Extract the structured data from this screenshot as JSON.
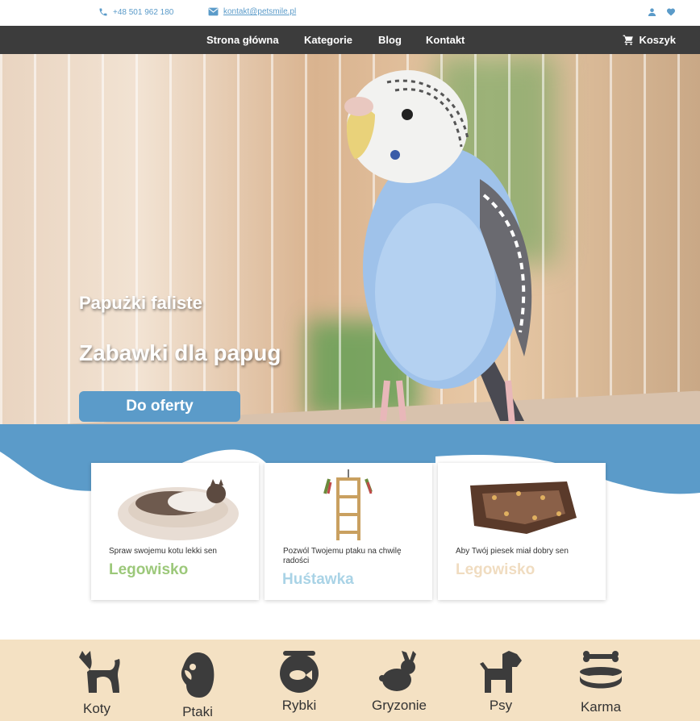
{
  "topbar": {
    "phone": "+48 501 962 180",
    "email": "kontakt@petsmile.pl",
    "phone_icon": "phone-icon",
    "email_icon": "mail-icon",
    "user_icon": "user-icon",
    "heart_icon": "heart-icon"
  },
  "nav": {
    "items": [
      "Strona główna",
      "Kategorie",
      "Blog",
      "Kontakt"
    ],
    "cart": "Koszyk",
    "cart_icon": "cart-icon"
  },
  "hero": {
    "subtitle": "Papużki faliste",
    "title": "Zabawki dla papug",
    "button": "Do oferty"
  },
  "products": [
    {
      "text": "Spraw swojemu kotu lekki sen",
      "name": "Legowisko",
      "name_color": "#9cc87a"
    },
    {
      "text": "Pozwól Twojemu ptaku na chwilę radości",
      "name": "Huśtawka",
      "name_color": "#a9d3e6"
    },
    {
      "text": "Aby Twój piesek miał dobry sen",
      "name": "Legowisko",
      "name_color": "#f0dcc0"
    }
  ],
  "categories": [
    {
      "label": "Koty",
      "icon": "cat-icon"
    },
    {
      "label": "Ptaki",
      "icon": "bird-icon"
    },
    {
      "label": "Rybki",
      "icon": "fishbowl-icon"
    },
    {
      "label": "Gryzonie",
      "icon": "rabbit-icon"
    },
    {
      "label": "Psy",
      "icon": "dog-icon"
    },
    {
      "label": "Karma",
      "icon": "food-bowl-icon"
    }
  ],
  "colors": {
    "accent": "#5b9bc9",
    "nav_bg": "#3c3c3c",
    "categories_bg": "#f4e1c3"
  }
}
